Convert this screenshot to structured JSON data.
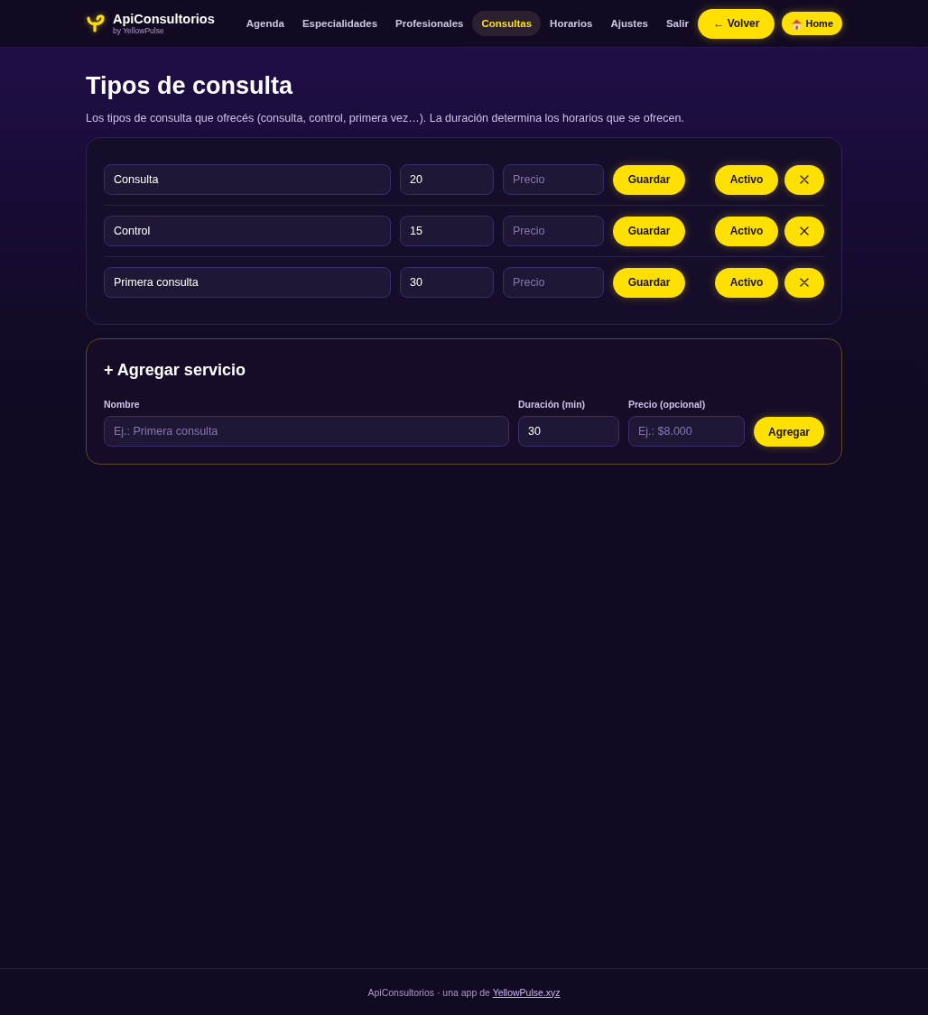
{
  "header": {
    "brand": {
      "name": "ApiConsultorios",
      "byline": "by YellowPulse"
    },
    "nav": [
      {
        "label": "Agenda",
        "selected": false
      },
      {
        "label": "Especialidades",
        "selected": false
      },
      {
        "label": "Profesionales",
        "selected": false
      },
      {
        "label": "Consultas",
        "selected": true
      },
      {
        "label": "Horarios",
        "selected": false
      },
      {
        "label": "Ajustes",
        "selected": false
      },
      {
        "label": "Salir",
        "selected": false
      }
    ],
    "actions": [
      {
        "kind": "back",
        "label": "← Volver"
      },
      {
        "kind": "home",
        "label": "Home"
      }
    ]
  },
  "page": {
    "title": "Tipos de consulta",
    "description": "Los tipos de consulta que ofrecés (consulta, control, primera vez…). La duración determina los horarios que se ofrecen."
  },
  "services": [
    {
      "name": "Consulta",
      "duration": "20",
      "price_placeholder": "Precio",
      "save_label": "Guardar",
      "status_label": "Activo"
    },
    {
      "name": "Control",
      "duration": "15",
      "price_placeholder": "Precio",
      "save_label": "Guardar",
      "status_label": "Activo"
    },
    {
      "name": "Primera consulta",
      "duration": "30",
      "price_placeholder": "Precio",
      "save_label": "Guardar",
      "status_label": "Activo"
    }
  ],
  "add_form": {
    "title": "+ Agregar servicio",
    "fields": [
      {
        "kind": "name",
        "label": "Nombre",
        "placeholder": "Ej.: Primera consulta"
      },
      {
        "kind": "duration",
        "label": "Duración (min)",
        "value": "30"
      },
      {
        "kind": "price",
        "label": "Precio (opcional)",
        "placeholder": "Ej.: $8.000"
      }
    ],
    "submit_label": "Agregar"
  },
  "footer": {
    "text": "ApiConsultorios · una app de",
    "link": "YellowPulse.xyz"
  }
}
